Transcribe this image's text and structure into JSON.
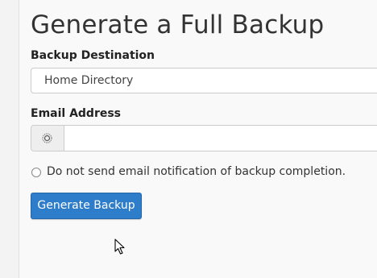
{
  "page": {
    "title": "Generate a Full Backup"
  },
  "form": {
    "destination": {
      "label": "Backup Destination",
      "selected": "Home Directory"
    },
    "email": {
      "label": "Email Address",
      "value": "",
      "addon_icon": "at-sign-icon"
    },
    "no_email_option": {
      "label": "Do not send email notification of backup completion.",
      "checked": false
    },
    "submit": {
      "label": "Generate Backup",
      "color": "#2e7dcb"
    }
  }
}
